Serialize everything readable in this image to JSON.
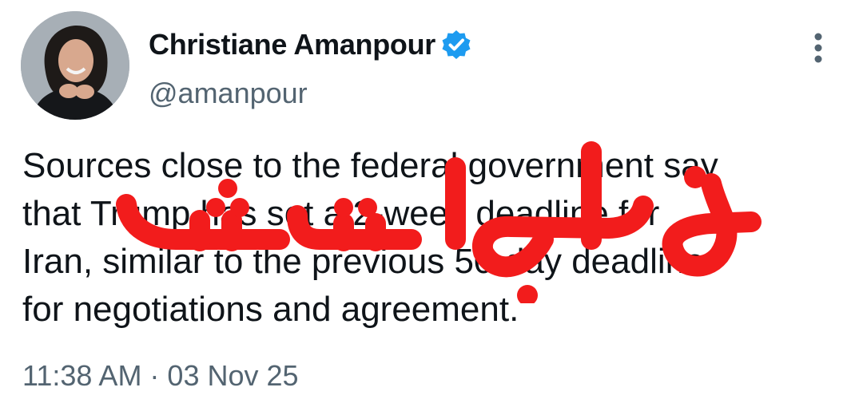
{
  "tweet": {
    "display_name": "Christiane Amanpour",
    "handle": "@amanpour",
    "text_lines": [
      "Sources close to the federal government say",
      "that Trump has set a 2-week deadline for",
      "Iran, similar to the previous 50-day deadline",
      "for negotiations and agreement."
    ],
    "timestamp": "11:38 AM · 03 Nov 25",
    "verified": true
  },
  "overlay": {
    "stamp_text": "جعلی است",
    "stamp_color": "#f21c1c"
  },
  "icons": {
    "verified": "verified-badge-icon",
    "more": "more-vertical-icon"
  },
  "colors": {
    "verified_blue": "#1d9bf0",
    "text_primary": "#0f1419",
    "text_secondary": "#536471"
  }
}
